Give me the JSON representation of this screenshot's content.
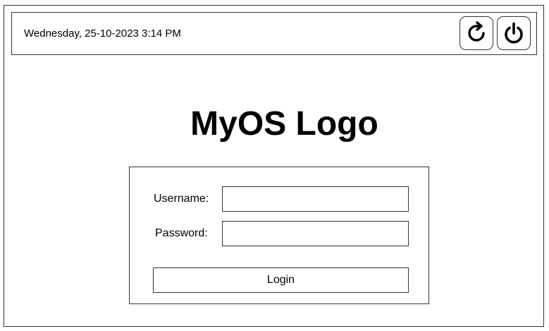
{
  "header": {
    "datetime": "Wednesday, 25-10-2023 3:14 PM",
    "restart_icon": "restart-icon",
    "power_icon": "power-icon"
  },
  "logo": {
    "text": "MyOS Logo"
  },
  "login": {
    "username_label": "Username:",
    "username_value": "",
    "password_label": "Password:",
    "password_value": "",
    "button_label": "Login"
  }
}
